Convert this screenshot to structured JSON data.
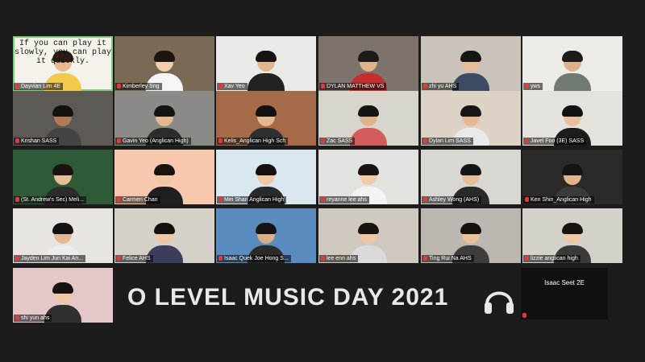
{
  "participants": [
    {
      "name": "Dayvian Lim 4E",
      "bg": "#f4f2ea",
      "skin": "#e7b98c",
      "hair": "#2a1d14",
      "shirt": "#f2c94c",
      "quote": "If you can play it slowly, you can play it quickly.",
      "active": true
    },
    {
      "name": "Kimberley Sng",
      "bg": "#7a6a55",
      "skin": "#f0cfae",
      "hair": "#1e1410",
      "shirt": "#f5f5f5"
    },
    {
      "name": "Xav Yeo",
      "bg": "#e9e9e7",
      "skin": "#e4b58d",
      "hair": "#151515",
      "shirt": "#222222"
    },
    {
      "name": "DYLAN MATTHEW VS",
      "bg": "#7e736a",
      "skin": "#e2b089",
      "hair": "#1b1b1b",
      "shirt": "#c62e2e"
    },
    {
      "name": "zhi yu AHS",
      "bg": "#c9c3b9",
      "skin": "#e6bd96",
      "hair": "#161616",
      "shirt": "#3d4a63"
    },
    {
      "name": "yws",
      "bg": "#ecebe6",
      "skin": "#dfb089",
      "hair": "#1c1c1c",
      "shirt": "#707a70"
    },
    {
      "name": "Krishan SASS",
      "bg": "#5d5a55",
      "skin": "#b07a55",
      "hair": "#111111",
      "shirt": "#444444"
    },
    {
      "name": "Gavin Yeo (Anglican High)",
      "bg": "#8b8a86",
      "skin": "#e4b891",
      "hair": "#141414",
      "shirt": "#2c2c2c"
    },
    {
      "name": "Kelis_Anglican High Sch",
      "bg": "#a56a48",
      "skin": "#e4b891",
      "hair": "#111111",
      "shirt": "#303030"
    },
    {
      "name": "Zac SASS",
      "bg": "#d8d5cd",
      "skin": "#dfb48d",
      "hair": "#141414",
      "shirt": "#d35c5c"
    },
    {
      "name": "Dylan Lim SASS",
      "bg": "#dcd3c6",
      "skin": "#e4b891",
      "hair": "#161616",
      "shirt": "#e9e9e9"
    },
    {
      "name": "Javel Foo (3E) SASS",
      "bg": "#e4e2dc",
      "skin": "#e6c09b",
      "hair": "#121212",
      "shirt": "#1d1d1d"
    },
    {
      "name": "(St. Andrew's Sec) Meli...",
      "bg": "#2f5a38",
      "skin": "#e6bd96",
      "hair": "#1a1410",
      "shirt": "#2c2c2c"
    },
    {
      "name": "Carmen Chan",
      "bg": "#f7c8ad",
      "skin": "#f0c8a4",
      "hair": "#1b1410",
      "shirt": "#1f1f1f"
    },
    {
      "name": "Mei Shan Anglican High",
      "bg": "#d9e7ef",
      "skin": "#f0c8a4",
      "hair": "#161110",
      "shirt": "#2a2a2a"
    },
    {
      "name": "reyanne lee ahs",
      "bg": "#e2e2de",
      "skin": "#f0cba8",
      "hair": "#1a1410",
      "shirt": "#f3f3f3"
    },
    {
      "name": "Ashley Wong (AHS)",
      "bg": "#d8d7d2",
      "skin": "#e6bd96",
      "hair": "#141414",
      "shirt": "#2a2a2a"
    },
    {
      "name": "Ken Shin_Anglican High",
      "bg": "#2c2a28",
      "skin": "#e0b48c",
      "hair": "#141414",
      "shirt": "#3b3b3b"
    },
    {
      "name": "Jayden Lim Jun Kai An...",
      "bg": "#e8e4df",
      "skin": "#e2b792",
      "hair": "#121212",
      "shirt": "#ececec"
    },
    {
      "name": "Felice AHS",
      "bg": "#d6d1c8",
      "skin": "#efc7a2",
      "hair": "#15110e",
      "shirt": "#3c3c5c"
    },
    {
      "name": "Isaac Quek Joe Hong S...",
      "bg": "#5a8cc0",
      "skin": "#d9ad86",
      "hair": "#151515",
      "shirt": "#2b2b2b"
    },
    {
      "name": "lee enn ahs",
      "bg": "#cfc9bf",
      "skin": "#efc6a1",
      "hair": "#1a1410",
      "shirt": "#d9d9d9"
    },
    {
      "name": "Ting Rui Na AHS",
      "bg": "#bcb8b1",
      "skin": "#e8c09a",
      "hair": "#151210",
      "shirt": "#3d3d3d"
    },
    {
      "name": "lizzie anglican high",
      "bg": "#d4d0ca",
      "skin": "#efc7a2",
      "hair": "#181310",
      "shirt": "#3a3a3a"
    },
    {
      "name": "shi yun ahs",
      "bg": "#e6c7c7",
      "skin": "#efc7a2",
      "hair": "#181310",
      "shirt": "#2f2f2f"
    }
  ],
  "banner": {
    "title": "O LEVEL MUSIC DAY 2021",
    "icon": "headphones-icon"
  },
  "no_video_tile": {
    "name": "Isaac Seet 2E"
  }
}
